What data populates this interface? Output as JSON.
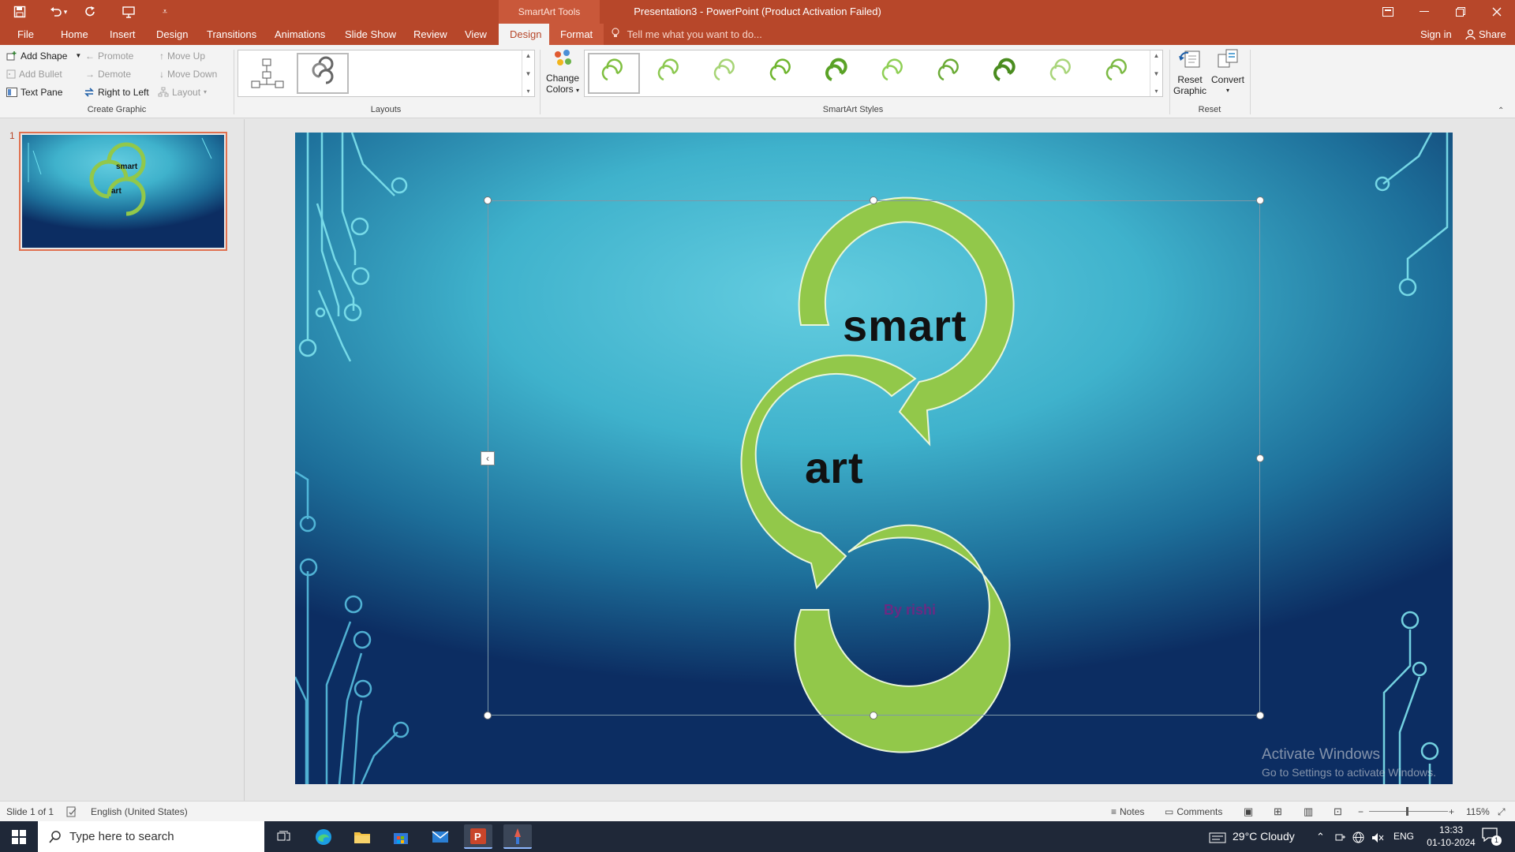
{
  "window": {
    "title": "Presentation3 - PowerPoint (Product Activation Failed)",
    "context_tab_group": "SmartArt Tools",
    "tell_me_placeholder": "Tell me what you want to do...",
    "sign_in": "Sign in",
    "share": "Share"
  },
  "tabs": [
    "File",
    "Home",
    "Insert",
    "Design",
    "Transitions",
    "Animations",
    "Slide Show",
    "Review",
    "View",
    "Design",
    "Format"
  ],
  "active_tab_index": 9,
  "ribbon": {
    "create_graphic": {
      "label": "Create Graphic",
      "add_shape": "Add Shape",
      "add_bullet": "Add Bullet",
      "text_pane": "Text Pane",
      "promote": "Promote",
      "demote": "Demote",
      "right_to_left": "Right to Left",
      "move_up": "Move Up",
      "move_down": "Move Down",
      "layout": "Layout"
    },
    "layouts": {
      "label": "Layouts"
    },
    "smartart_styles": {
      "label": "SmartArt Styles",
      "change_colors_1": "Change",
      "change_colors_2": "Colors"
    },
    "reset": {
      "label": "Reset",
      "reset_graphic_1": "Reset",
      "reset_graphic_2": "Graphic",
      "convert": "Convert"
    }
  },
  "slide_panel": {
    "slide_number": "1",
    "thumb_texts": [
      "smart",
      "art",
      "..."
    ]
  },
  "slide": {
    "shape_texts": [
      "smart",
      "art",
      "By rishi"
    ],
    "watermark_title": "Activate Windows",
    "watermark_sub": "Go to Settings to activate Windows."
  },
  "status": {
    "slide_of": "Slide 1 of 1",
    "language": "English (United States)",
    "notes": "Notes",
    "comments": "Comments",
    "zoom": "115%"
  },
  "taskbar": {
    "search_placeholder": "Type here to search",
    "weather": "29°C  Cloudy",
    "lang": "ENG",
    "time": "13:33",
    "date": "01-10-2024",
    "notif_count": "1"
  },
  "colors": {
    "accent": "#b7472a",
    "smartart_green": "#92c84a",
    "byline": "#6b2a83"
  }
}
